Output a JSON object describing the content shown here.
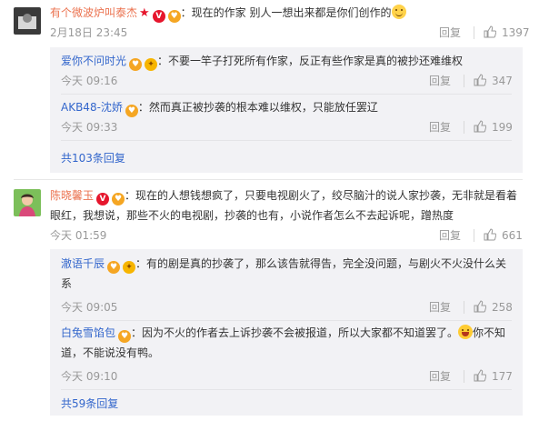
{
  "labels": {
    "reply": "回复"
  },
  "comments": [
    {
      "user": "有个微波炉叫泰杰",
      "text": "：现在的作家 别人一想出来都是你们创作的",
      "time": "2月18日 23:45",
      "likes": "1397",
      "replies": [
        {
          "user": "爱你不问时光",
          "text": "：不要一竿子打死所有作家，反正有些作家是真的被抄还难维权",
          "time": "今天 09:16",
          "likes": "347"
        },
        {
          "user": "AKB48-沈娇",
          "text": "：然而真正被抄袭的根本难以维权，只能放任罢辽",
          "time": "今天 09:33",
          "likes": "199"
        }
      ],
      "more": "共103条回复"
    },
    {
      "user": "陈晓馨玉",
      "text_line1": "：现在的人想钱想疯了，只要电视剧火了，绞尽脑汁的说人家抄袭，无非就是看着",
      "text_line2": "眼红，我想说，那些不火的电视剧，抄袭的也有，小说作者怎么不去起诉呢，蹭热度",
      "time": "今天 01:59",
      "likes": "661",
      "replies": [
        {
          "user": "澈语千辰",
          "text_line1": "：有的剧是真的抄袭了，那么该告就得告，完全没问题，与剧火不火没什么关",
          "text_line2": "系",
          "time": "今天 09:05",
          "likes": "258"
        },
        {
          "user": "白兔雪馅包",
          "text_line1": "：因为不火的作者去上诉抄袭不会被报道，所以大家都不知道罢了。",
          "text_line1b": "你不知",
          "text_line2": "道，不能说没有鸭。",
          "time": "今天 09:10",
          "likes": "177"
        }
      ],
      "more": "共59条回复"
    }
  ]
}
